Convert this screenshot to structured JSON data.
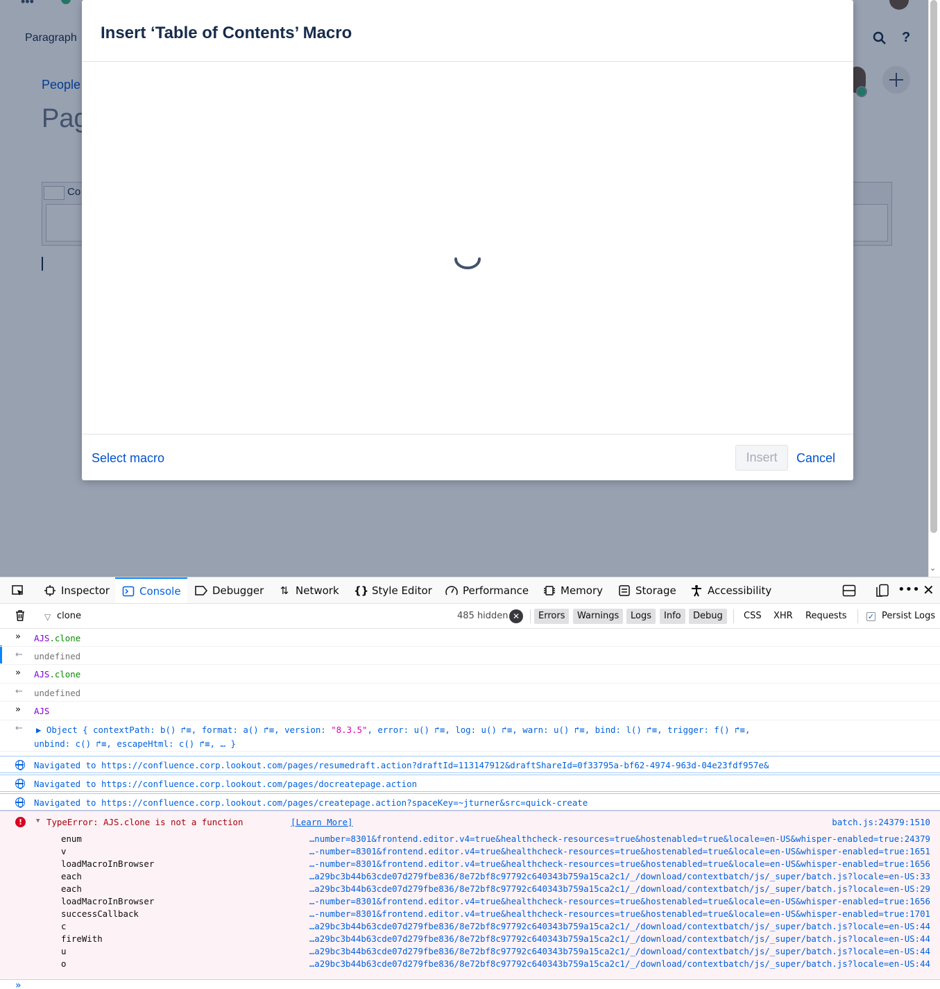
{
  "page": {
    "toolbar_label": "Paragraph",
    "breadcrumb": "People",
    "title_partial": "Pag",
    "table_cell_partial": "Co"
  },
  "dialog": {
    "title": "Insert ‘Table of Contents’ Macro",
    "select_macro": "Select macro",
    "insert": "Insert",
    "cancel": "Cancel"
  },
  "devtools": {
    "tabs": {
      "inspector": "Inspector",
      "console": "Console",
      "debugger": "Debugger",
      "network": "Network",
      "style_editor": "Style Editor",
      "performance": "Performance",
      "memory": "Memory",
      "storage": "Storage",
      "accessibility": "Accessibility"
    },
    "filter": {
      "text": "clone",
      "hidden": "485 hidden",
      "errors": "Errors",
      "warnings": "Warnings",
      "logs": "Logs",
      "info": "Info",
      "debug": "Debug",
      "css": "CSS",
      "xhr": "XHR",
      "requests": "Requests",
      "persist": "Persist Logs"
    },
    "console": {
      "in1_obj": "AJS",
      "in1_prop": ".clone",
      "out1": "undefined",
      "in2_obj": "AJS",
      "in2_prop": ".clone",
      "out2": "undefined",
      "in3": "AJS",
      "obj_line1": "▶ Object { contextPath: b() ↱≡, format: a() ↱≡, version: ",
      "obj_version": "\"8.3.5\"",
      "obj_line1b": ", error: u() ↱≡, log: u() ↱≡, warn: u() ↱≡, bind: l() ↱≡, trigger: f() ↱≡,",
      "obj_line2": "unbind: c() ↱≡, escapeHtml: c() ↱≡, … }",
      "nav1": "Navigated to https://confluence.corp.lookout.com/pages/resumedraft.action?draftId=113147912&draftShareId=0f33795a-bf62-4974-963d-04e23fdf957e&",
      "nav2": "Navigated to https://confluence.corp.lookout.com/pages/docreatepage.action",
      "nav3": "Navigated to https://confluence.corp.lookout.com/pages/createpage.action?spaceKey=~jturner&src=quick-create",
      "error": {
        "message": "TypeError: AJS.clone is not a function",
        "learn_more": "[Learn More]",
        "source": "batch.js:24379:1510",
        "stack": [
          {
            "fn": "enum",
            "loc": "…number=8301&frontend.editor.v4=true&healthcheck-resources=true&hostenabled=true&locale=en-US&whisper-enabled=true:24379"
          },
          {
            "fn": "v",
            "loc": "…-number=8301&frontend.editor.v4=true&healthcheck-resources=true&hostenabled=true&locale=en-US&whisper-enabled=true:1651"
          },
          {
            "fn": "loadMacroInBrowser",
            "loc": "…-number=8301&frontend.editor.v4=true&healthcheck-resources=true&hostenabled=true&locale=en-US&whisper-enabled=true:1656"
          },
          {
            "fn": "each",
            "loc": "…a29bc3b44b63cde07d279fbe836/8e72bf8c97792c640343b759a15ca2c1/_/download/contextbatch/js/_super/batch.js?locale=en-US:33"
          },
          {
            "fn": "each",
            "loc": "…a29bc3b44b63cde07d279fbe836/8e72bf8c97792c640343b759a15ca2c1/_/download/contextbatch/js/_super/batch.js?locale=en-US:29"
          },
          {
            "fn": "loadMacroInBrowser",
            "loc": "…-number=8301&frontend.editor.v4=true&healthcheck-resources=true&hostenabled=true&locale=en-US&whisper-enabled=true:1656"
          },
          {
            "fn": "successCallback",
            "loc": "…-number=8301&frontend.editor.v4=true&healthcheck-resources=true&hostenabled=true&locale=en-US&whisper-enabled=true:1701"
          },
          {
            "fn": "c",
            "loc": "…a29bc3b44b63cde07d279fbe836/8e72bf8c97792c640343b759a15ca2c1/_/download/contextbatch/js/_super/batch.js?locale=en-US:44"
          },
          {
            "fn": "fireWith",
            "loc": "…a29bc3b44b63cde07d279fbe836/8e72bf8c97792c640343b759a15ca2c1/_/download/contextbatch/js/_super/batch.js?locale=en-US:44"
          },
          {
            "fn": "u",
            "loc": "…a29bc3b44b63cde07d279fbe836/8e72bf8c97792c640343b759a15ca2c1/_/download/contextbatch/js/_super/batch.js?locale=en-US:44"
          },
          {
            "fn": "o",
            "loc": "…a29bc3b44b63cde07d279fbe836/8e72bf8c97792c640343b759a15ca2c1/_/download/contextbatch/js/_super/batch.js?locale=en-US:44"
          }
        ]
      },
      "prompt": "»"
    }
  },
  "icons": {
    "picker": "element-picker-icon",
    "inspector": "inspector-icon",
    "console": "console-icon",
    "debugger": "debugger-icon",
    "network": "network-icon",
    "style_editor": "style-editor-icon",
    "performance": "performance-icon",
    "memory": "memory-icon",
    "storage": "storage-icon",
    "accessibility": "accessibility-icon",
    "dock": "dock-icon",
    "split": "split-console-icon",
    "more": "more-icon",
    "close": "close-icon",
    "trash": "trash-icon",
    "filter": "filter-icon",
    "error": "error-icon",
    "globe": "globe-icon",
    "search": "search-icon",
    "help": "help-icon",
    "add": "add-icon",
    "spinner": "spinner-icon"
  },
  "colors": {
    "accent": "#0060df",
    "link": "#0052cc",
    "error_text": "#a4000f",
    "error_bg": "#fdf2f5"
  }
}
